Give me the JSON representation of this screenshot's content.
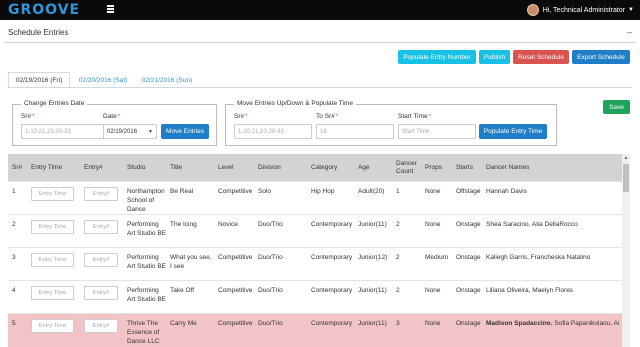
{
  "app": {
    "logo": "GROOVE",
    "user_greeting": "Hi, Technical Administrator"
  },
  "panel": {
    "title": "Schedule Entries",
    "collapse": "–"
  },
  "toolbar": {
    "populate_entry_number": "Populate Entry Number",
    "publish": "Publish",
    "reset_schedule": "Reset Schedule",
    "export_schedule": "Export Schedule"
  },
  "tabs": [
    "02/19/2016 (Fri)",
    "02/20/2016 (Sat)",
    "02/21/2016 (Sun)"
  ],
  "change_entries": {
    "legend": "Change Entries Date",
    "sr_label": "Sr#",
    "sr_placeholder": "1-10,21,23,30-33",
    "date_label": "Date",
    "date_value": "02/19/2016",
    "button": "Move Entries"
  },
  "move_entries": {
    "legend": "Move Entries Up/Down & Populate Time",
    "sr_label": "Sr#",
    "sr_placeholder": "1-10,21,23,30-33",
    "to_label": "To Sr#",
    "to_placeholder": "16",
    "start_label": "Start Time",
    "start_placeholder": "Start Time",
    "button": "Populate Entry Time"
  },
  "save_label": "Save",
  "table": {
    "headers": [
      "Sr#",
      "Entry Time",
      "Entry#",
      "Studio",
      "Title",
      "Level",
      "Division",
      "Category",
      "Age",
      "Dancer Count",
      "Props",
      "Starts",
      "Dancer Names"
    ],
    "entry_time_placeholder": "Entry Time",
    "entry_no_placeholder": "Entry#",
    "rows": [
      {
        "sr": "1",
        "studio": "Northampton School of Dance",
        "title": "Be Real",
        "level": "Competitive",
        "division": "Solo",
        "category": "Hip Hop",
        "age": "Adult(20)",
        "count": "1",
        "props": "None",
        "starts": "Offstage",
        "names": "Hannah Davis",
        "highlight": false
      },
      {
        "sr": "2",
        "studio": "Performing Art Studio BE",
        "title": "The Icing",
        "level": "Novice",
        "division": "Duo/Trio",
        "category": "Contemporary",
        "age": "Junior(11)",
        "count": "2",
        "props": "None",
        "starts": "Onstage",
        "names": "Shea Saracino, Alia DellaRocco",
        "highlight": false
      },
      {
        "sr": "3",
        "studio": "Performing Art Studio BE",
        "title": "What you see, I see",
        "level": "Competitive",
        "division": "Duo/Trio",
        "category": "Contemporary",
        "age": "Junior(12)",
        "count": "2",
        "props": "Medium",
        "starts": "Onstage",
        "names": "Kaliegh Garris, Francheska Natalino",
        "highlight": false
      },
      {
        "sr": "4",
        "studio": "Performing Art Studio BE",
        "title": "Take Off",
        "level": "Competitive",
        "division": "Duo/Trio",
        "category": "Contemporary",
        "age": "Junior(11)",
        "count": "2",
        "props": "None",
        "starts": "Onstage",
        "names": "Liliana Oliveira, Maelyn Flores",
        "highlight": false
      },
      {
        "sr": "5",
        "studio": "Thrive The Essence of Dance LLC",
        "title": "Carry Me",
        "level": "Competitive",
        "division": "Duo/Trio",
        "category": "Contemporary",
        "age": "Junior(11)",
        "count": "3",
        "props": "None",
        "starts": "Onstage",
        "names_bold": "Madison Spadaccino",
        "names": ", Sofia Papanikolaou, Ai",
        "highlight": true
      }
    ]
  },
  "colors": {
    "topbar": "#0a0a0a",
    "logo": "#2f97d9",
    "highlight_row": "#f2c4c8",
    "header_bg": "#d3d3d3"
  },
  "icons": {
    "menu": "hamburger-icon",
    "user_dropdown": "chevron-down-icon",
    "select_caret": "caret-down-icon",
    "scroll_up": "triangle-up-icon"
  }
}
